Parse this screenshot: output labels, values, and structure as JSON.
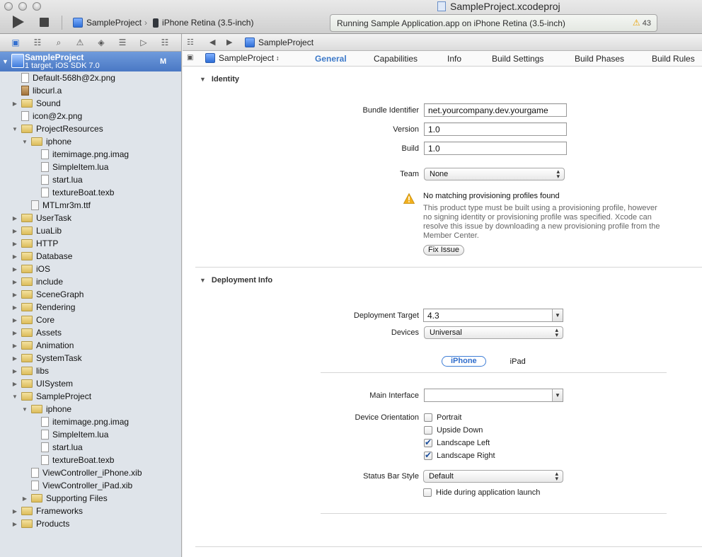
{
  "window": {
    "document_title": "SampleProject.xcodeproj",
    "scheme": "SampleProject",
    "destination": "iPhone Retina (3.5-inch)",
    "activity_status": "Running Sample Application.app on iPhone Retina (3.5-inch)",
    "warning_count": "43"
  },
  "navigator": {
    "project": {
      "name": "SampleProject",
      "subtitle": "1 target, iOS SDK 7.0",
      "badge": "M"
    },
    "tree": [
      {
        "label": "Default-568h@2x.png",
        "kind": "file",
        "depth": 1,
        "disclosure": ""
      },
      {
        "label": "libcurl.a",
        "kind": "lib",
        "depth": 1,
        "disclosure": ""
      },
      {
        "label": "Sound",
        "kind": "folder",
        "depth": 1,
        "disclosure": "closed"
      },
      {
        "label": "icon@2x.png",
        "kind": "file",
        "depth": 1,
        "disclosure": ""
      },
      {
        "label": "ProjectResources",
        "kind": "folder",
        "depth": 1,
        "disclosure": "open"
      },
      {
        "label": "iphone",
        "kind": "folder",
        "depth": 2,
        "disclosure": "open"
      },
      {
        "label": "itemimage.png.imag",
        "kind": "file",
        "depth": 3,
        "disclosure": ""
      },
      {
        "label": "SimpleItem.lua",
        "kind": "file",
        "depth": 3,
        "disclosure": ""
      },
      {
        "label": "start.lua",
        "kind": "file",
        "depth": 3,
        "disclosure": ""
      },
      {
        "label": "textureBoat.texb",
        "kind": "file",
        "depth": 3,
        "disclosure": ""
      },
      {
        "label": "MTLmr3m.ttf",
        "kind": "ttf",
        "depth": 2,
        "disclosure": ""
      },
      {
        "label": "UserTask",
        "kind": "folder",
        "depth": 1,
        "disclosure": "closed"
      },
      {
        "label": "LuaLib",
        "kind": "folder",
        "depth": 1,
        "disclosure": "closed"
      },
      {
        "label": "HTTP",
        "kind": "folder",
        "depth": 1,
        "disclosure": "closed"
      },
      {
        "label": "Database",
        "kind": "folder",
        "depth": 1,
        "disclosure": "closed"
      },
      {
        "label": "iOS",
        "kind": "folder",
        "depth": 1,
        "disclosure": "closed"
      },
      {
        "label": "include",
        "kind": "folder",
        "depth": 1,
        "disclosure": "closed"
      },
      {
        "label": "SceneGraph",
        "kind": "folder",
        "depth": 1,
        "disclosure": "closed"
      },
      {
        "label": "Rendering",
        "kind": "folder",
        "depth": 1,
        "disclosure": "closed"
      },
      {
        "label": "Core",
        "kind": "folder",
        "depth": 1,
        "disclosure": "closed"
      },
      {
        "label": "Assets",
        "kind": "folder",
        "depth": 1,
        "disclosure": "closed"
      },
      {
        "label": "Animation",
        "kind": "folder",
        "depth": 1,
        "disclosure": "closed"
      },
      {
        "label": "SystemTask",
        "kind": "folder",
        "depth": 1,
        "disclosure": "closed"
      },
      {
        "label": "libs",
        "kind": "folder",
        "depth": 1,
        "disclosure": "closed"
      },
      {
        "label": "UISystem",
        "kind": "folder",
        "depth": 1,
        "disclosure": "closed"
      },
      {
        "label": "SampleProject",
        "kind": "folder",
        "depth": 1,
        "disclosure": "open"
      },
      {
        "label": "iphone",
        "kind": "folder",
        "depth": 2,
        "disclosure": "open"
      },
      {
        "label": "itemimage.png.imag",
        "kind": "file",
        "depth": 3,
        "disclosure": ""
      },
      {
        "label": "SimpleItem.lua",
        "kind": "file",
        "depth": 3,
        "disclosure": ""
      },
      {
        "label": "start.lua",
        "kind": "file",
        "depth": 3,
        "disclosure": ""
      },
      {
        "label": "textureBoat.texb",
        "kind": "file",
        "depth": 3,
        "disclosure": ""
      },
      {
        "label": "ViewController_iPhone.xib",
        "kind": "file",
        "depth": 2,
        "disclosure": ""
      },
      {
        "label": "ViewController_iPad.xib",
        "kind": "file",
        "depth": 2,
        "disclosure": ""
      },
      {
        "label": "Supporting Files",
        "kind": "folder",
        "depth": 2,
        "disclosure": "closed"
      },
      {
        "label": "Frameworks",
        "kind": "folder",
        "depth": 1,
        "disclosure": "closed"
      },
      {
        "label": "Products",
        "kind": "folder",
        "depth": 1,
        "disclosure": "closed"
      }
    ]
  },
  "editor": {
    "breadcrumb": "SampleProject",
    "target": "SampleProject",
    "tabs": [
      "General",
      "Capabilities",
      "Info",
      "Build Settings",
      "Build Phases",
      "Build Rules"
    ],
    "active_tab": "General",
    "identity": {
      "title": "Identity",
      "bundle_identifier_label": "Bundle Identifier",
      "bundle_identifier": "net.yourcompany.dev.yourgame",
      "version_label": "Version",
      "version": "1.0",
      "build_label": "Build",
      "build": "1.0",
      "team_label": "Team",
      "team": "None",
      "warning_title": "No matching provisioning profiles found",
      "warning_body": "This product type must be built using a provisioning profile, however no signing identity or provisioning profile was specified.  Xcode can resolve this issue by downloading a new provisioning profile from the Member Center.",
      "fix_button": "Fix Issue"
    },
    "deployment": {
      "title": "Deployment Info",
      "target_label": "Deployment Target",
      "target": "4.3",
      "devices_label": "Devices",
      "devices": "Universal",
      "segment_iphone": "iPhone",
      "segment_ipad": "iPad",
      "main_interface_label": "Main Interface",
      "main_interface": "",
      "orientation_label": "Device Orientation",
      "orientations": [
        {
          "label": "Portrait",
          "checked": false
        },
        {
          "label": "Upside Down",
          "checked": false
        },
        {
          "label": "Landscape Left",
          "checked": true
        },
        {
          "label": "Landscape Right",
          "checked": true
        }
      ],
      "status_bar_label": "Status Bar Style",
      "status_bar": "Default",
      "hide_status_bar": "Hide during application launch",
      "hide_status_bar_checked": false
    }
  },
  "colors": {
    "selection": "#4a78c4",
    "active_tab": "#3c79c9",
    "warning": "#e8a000"
  }
}
